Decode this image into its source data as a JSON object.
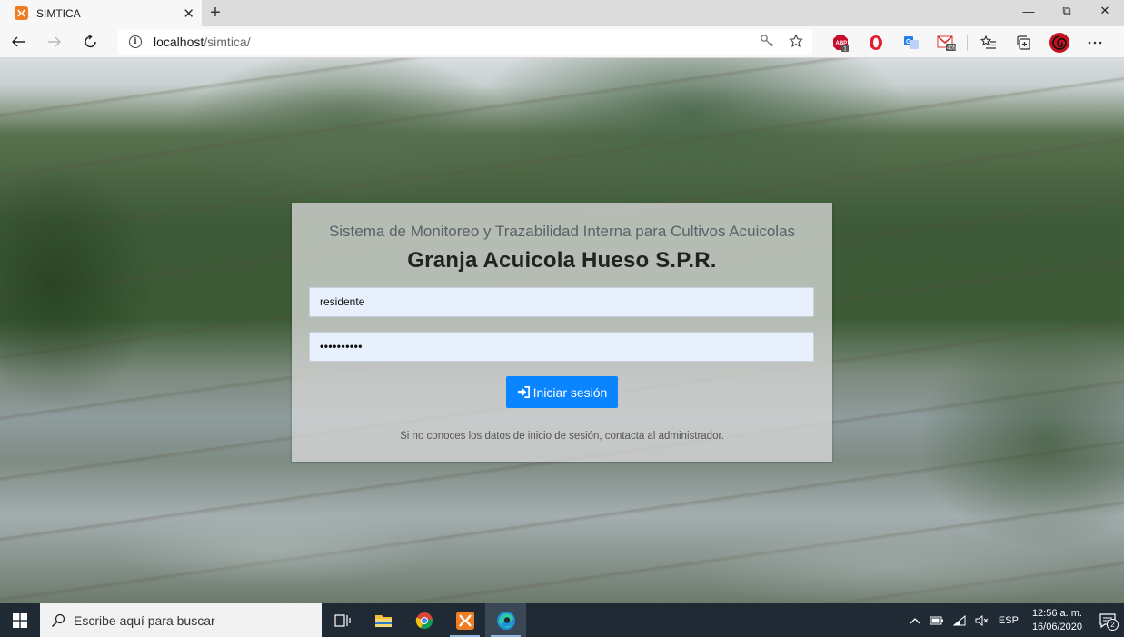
{
  "browser": {
    "tab_title": "SIMTICA",
    "tab_close": "✕",
    "new_tab": "+",
    "url_host": "localhost",
    "url_path": "/simtica/",
    "controls": {
      "minimize": "—",
      "restore": "⧉",
      "close": "✕"
    },
    "extension_badges": {
      "abp": "1",
      "gmail": "405"
    }
  },
  "login": {
    "subtitle": "Sistema de Monitoreo y Trazabilidad Interna para Cultivos Acuicolas",
    "title": "Granja Acuicola Hueso S.P.R.",
    "username_value": "residente",
    "password_value": "••••••••••",
    "submit_label": "Iniciar sesión",
    "help_text": "Si no conoces los datos de inicio de sesión, contacta al administrador.",
    "button_color": "#0a84ff"
  },
  "taskbar": {
    "search_placeholder": "Escribe aquí para buscar",
    "language": "ESP",
    "time": "12:56 a. m.",
    "date": "16/06/2020",
    "notification_count": "2"
  }
}
